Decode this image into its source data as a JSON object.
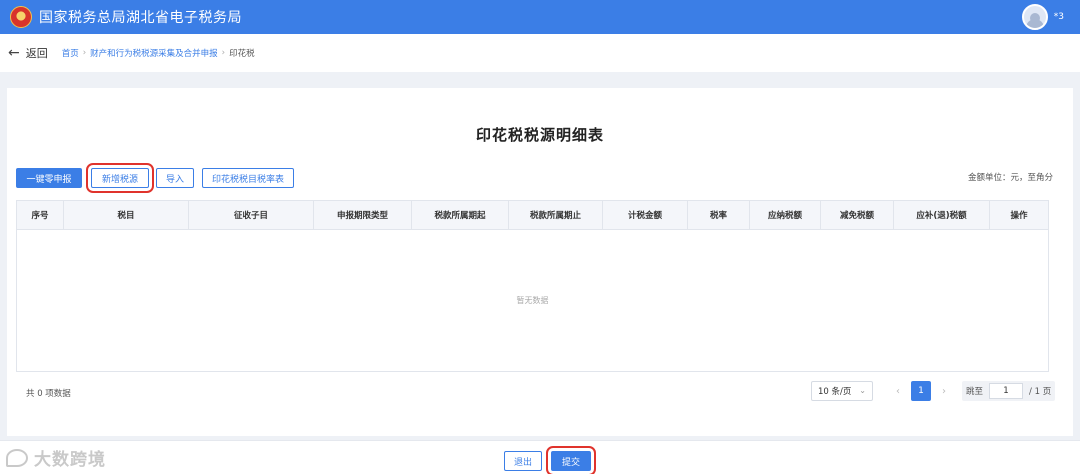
{
  "header": {
    "title": "国家税务总局湖北省电子税务局",
    "user_name": "*3",
    "brand_color": "#3b7ee6"
  },
  "nav": {
    "back_label": "返回",
    "breadcrumbs": [
      "首页",
      "财产和行为税税源采集及合并申报",
      "印花税"
    ]
  },
  "main": {
    "title": "印花税税源明细表",
    "buttons": {
      "zero_declare": "一键零申报",
      "add_source": "新增税源",
      "import": "导入",
      "rate_table": "印花税税目税率表"
    },
    "unit_note": "金额单位：元，至角分",
    "table": {
      "columns": [
        "序号",
        "税目",
        "征收子目",
        "申报期限类型",
        "税款所属期起",
        "税款所属期止",
        "计税金额",
        "税率",
        "应纳税额",
        "减免税额",
        "应补(退)税额",
        "操作"
      ],
      "rows": [],
      "empty_text": "暂无数据"
    },
    "pagination": {
      "total_text": "共 0 项数据",
      "page_size": "10 条/页",
      "current_page": "1",
      "goto_label": "跳至",
      "goto_value": "1",
      "total_pages_text": "/ 1 页"
    }
  },
  "footer": {
    "exit_label": "退出",
    "submit_label": "提交",
    "watermark": "大数跨境"
  },
  "icons": {
    "back": "arrow-left-icon",
    "logo": "tax-emblem-icon",
    "avatar": "user-avatar-icon"
  }
}
